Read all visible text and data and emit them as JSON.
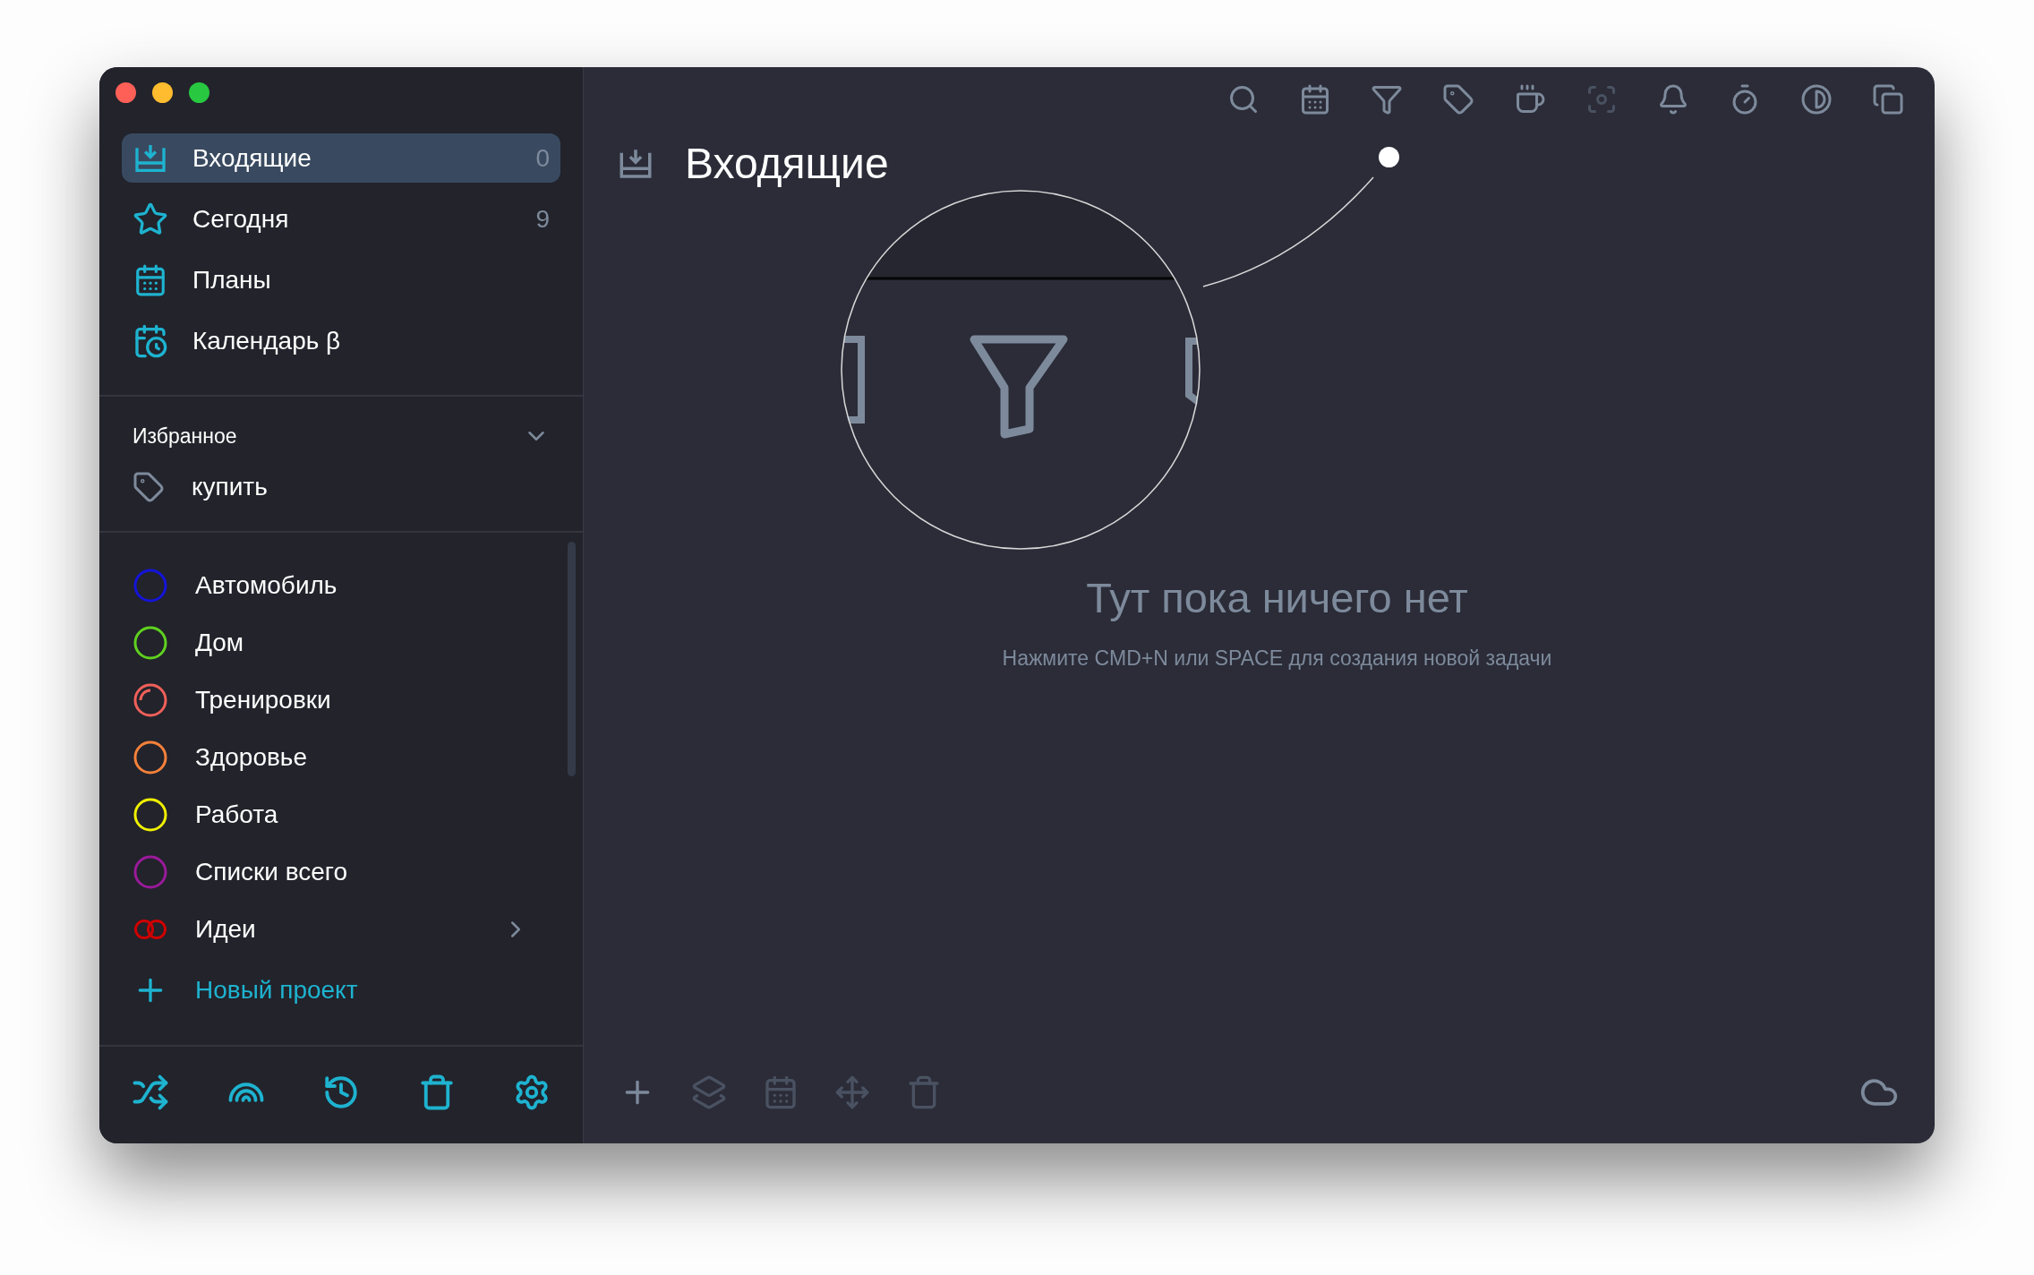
{
  "sidebar": {
    "nav": [
      {
        "label": "Входящие",
        "count": "0",
        "selected": true
      },
      {
        "label": "Сегодня",
        "count": "9",
        "selected": false
      },
      {
        "label": "Планы",
        "selected": false
      },
      {
        "label": "Календарь β",
        "selected": false
      }
    ],
    "favorites": {
      "title": "Избранное",
      "expanded": true,
      "items": [
        {
          "label": "купить"
        }
      ]
    },
    "projects": [
      {
        "label": "Автомобиль",
        "kind": "ring",
        "color": "#1414d8"
      },
      {
        "label": "Дом",
        "kind": "ring",
        "color": "#5fd11f"
      },
      {
        "label": "Тренировки",
        "kind": "progress",
        "color": "#f0605a",
        "level": 0.25
      },
      {
        "label": "Здоровье",
        "kind": "ring",
        "color": "#f5813a"
      },
      {
        "label": "Работа",
        "kind": "ring",
        "color": "#f0f000"
      },
      {
        "label": "Списки всего",
        "kind": "ring",
        "color": "#9a1a9a"
      },
      {
        "label": "Идеи",
        "kind": "group",
        "color": "#d00000",
        "expanded": false
      }
    ],
    "new_project": "Новый проект"
  },
  "toolbar": [
    {
      "disabled": false
    },
    {
      "disabled": false
    },
    {
      "disabled": false
    },
    {
      "disabled": false
    },
    {
      "disabled": false
    },
    {
      "disabled": true
    },
    {
      "disabled": false
    },
    {
      "disabled": false
    },
    {
      "disabled": false
    },
    {
      "disabled": false
    }
  ],
  "header": {
    "title": "Входящие"
  },
  "empty_state": {
    "title": "Тут пока ничего нет",
    "hint": "Нажмите CMD+N или SPACE для создания новой задачи"
  },
  "bottom_bar": [
    {
      "disabled": false
    },
    {
      "disabled": true
    },
    {
      "disabled": true
    },
    {
      "disabled": true
    },
    {
      "disabled": true
    }
  ]
}
